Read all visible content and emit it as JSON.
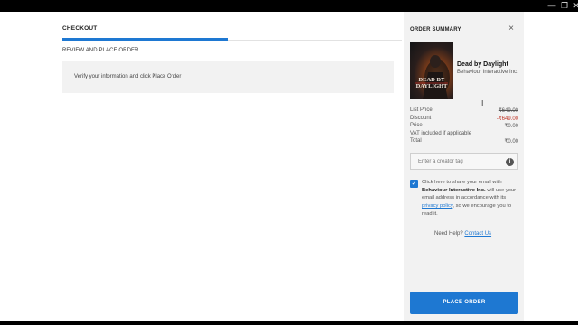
{
  "window": {
    "minimize_icon": "minimize-icon",
    "maximize_icon": "maximize-icon",
    "close_icon": "close-icon"
  },
  "checkout": {
    "tab_label": "CHECKOUT",
    "step_progress": 0.49,
    "review_heading": "REVIEW AND PLACE ORDER",
    "verify_text": "Verify your information and click Place Order"
  },
  "summary": {
    "title": "ORDER SUMMARY",
    "close_label": "×",
    "game": {
      "title": "Dead by Daylight",
      "publisher": "Behaviour Interactive Inc.",
      "cover_text_1": "DEAD BY",
      "cover_text_2": "DAYLIGHT"
    },
    "prices": {
      "list_price_label": "List Price",
      "list_price_value": "₹649.00",
      "discount_label": "Discount",
      "discount_value": "-₹649.00",
      "price_label": "Price",
      "price_value": "₹0.00",
      "vat_note": "VAT included if applicable",
      "total_label": "Total",
      "total_value": "₹0.00"
    },
    "creator_tag": {
      "placeholder": "Enter a creator tag",
      "info_label": "i"
    },
    "consent": {
      "checked": true,
      "check_mark": "✓",
      "text_1": "Click here to share your email with",
      "company": "Behaviour Interactive Inc.",
      "text_2": "will use your email address in accordance with its",
      "privacy_link": "privacy policy",
      "text_3": ", so we encourage you to read it."
    },
    "help": {
      "text": "Need Help?",
      "link": "Contact Us"
    },
    "place_order_label": "PLACE ORDER"
  },
  "colors": {
    "accent": "#1e78d2",
    "discount": "#c0392b",
    "panel_bg": "#f2f2f2"
  }
}
